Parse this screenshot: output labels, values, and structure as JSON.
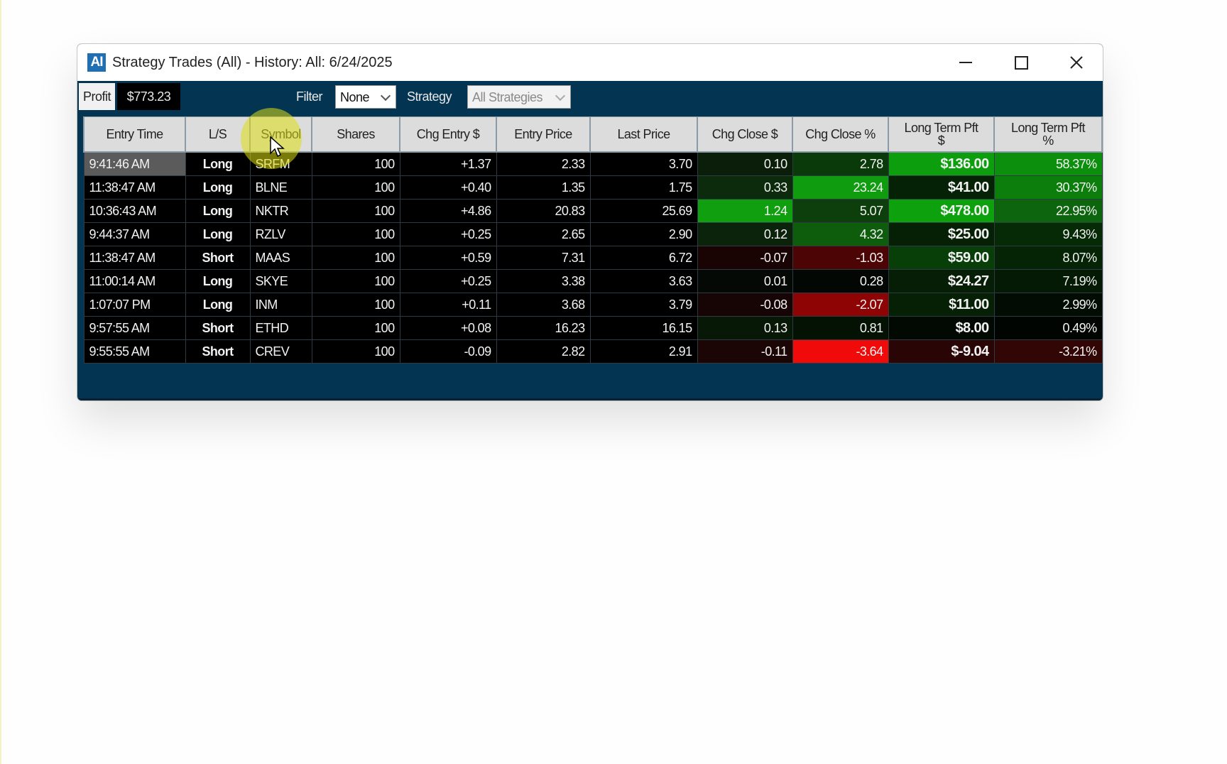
{
  "window": {
    "icon_text": "AI",
    "title": "Strategy Trades (All) - History: All: 6/24/2025"
  },
  "toolbar": {
    "profit_label": "Profit",
    "profit_value": "$773.23",
    "filter_label": "Filter",
    "filter_value": "None",
    "strategy_label": "Strategy",
    "strategy_value": "All Strategies"
  },
  "table": {
    "columns": [
      "Entry Time",
      "L/S",
      "Symbol",
      "Shares",
      "Chg Entry $",
      "Entry Price",
      "Last Price",
      "Chg Close $",
      "Chg Close %",
      "Long Term Pft $",
      "Long Term Pft %"
    ],
    "rows": [
      {
        "entry_time": "9:41:46 AM",
        "ls": "Long",
        "symbol": "SRFM",
        "shares": "100",
        "chg_entry": "+1.37",
        "entry_price": "2.33",
        "last_price": "3.70",
        "chg_close": "0.10",
        "chg_close_pct": "2.78",
        "lt_pft": "$136.00",
        "lt_pft_pct": "58.37%"
      },
      {
        "entry_time": "11:38:47 AM",
        "ls": "Long",
        "symbol": "BLNE",
        "shares": "100",
        "chg_entry": "+0.40",
        "entry_price": "1.35",
        "last_price": "1.75",
        "chg_close": "0.33",
        "chg_close_pct": "23.24",
        "lt_pft": "$41.00",
        "lt_pft_pct": "30.37%"
      },
      {
        "entry_time": "10:36:43 AM",
        "ls": "Long",
        "symbol": "NKTR",
        "shares": "100",
        "chg_entry": "+4.86",
        "entry_price": "20.83",
        "last_price": "25.69",
        "chg_close": "1.24",
        "chg_close_pct": "5.07",
        "lt_pft": "$478.00",
        "lt_pft_pct": "22.95%"
      },
      {
        "entry_time": "9:44:37 AM",
        "ls": "Long",
        "symbol": "RZLV",
        "shares": "100",
        "chg_entry": "+0.25",
        "entry_price": "2.65",
        "last_price": "2.90",
        "chg_close": "0.12",
        "chg_close_pct": "4.32",
        "lt_pft": "$25.00",
        "lt_pft_pct": "9.43%"
      },
      {
        "entry_time": "11:38:47 AM",
        "ls": "Short",
        "symbol": "MAAS",
        "shares": "100",
        "chg_entry": "+0.59",
        "entry_price": "7.31",
        "last_price": "6.72",
        "chg_close": "-0.07",
        "chg_close_pct": "-1.03",
        "lt_pft": "$59.00",
        "lt_pft_pct": "8.07%"
      },
      {
        "entry_time": "11:00:14 AM",
        "ls": "Long",
        "symbol": "SKYE",
        "shares": "100",
        "chg_entry": "+0.25",
        "entry_price": "3.38",
        "last_price": "3.63",
        "chg_close": "0.01",
        "chg_close_pct": "0.28",
        "lt_pft": "$24.27",
        "lt_pft_pct": "7.19%"
      },
      {
        "entry_time": "1:07:07 PM",
        "ls": "Long",
        "symbol": "INM",
        "shares": "100",
        "chg_entry": "+0.11",
        "entry_price": "3.68",
        "last_price": "3.79",
        "chg_close": "-0.08",
        "chg_close_pct": "-2.07",
        "lt_pft": "$11.00",
        "lt_pft_pct": "2.99%"
      },
      {
        "entry_time": "9:57:55 AM",
        "ls": "Short",
        "symbol": "ETHD",
        "shares": "100",
        "chg_entry": "+0.08",
        "entry_price": "16.23",
        "last_price": "16.15",
        "chg_close": "0.13",
        "chg_close_pct": "0.81",
        "lt_pft": "$8.00",
        "lt_pft_pct": "0.49%"
      },
      {
        "entry_time": "9:55:55 AM",
        "ls": "Short",
        "symbol": "CREV",
        "shares": "100",
        "chg_entry": "-0.09",
        "entry_price": "2.82",
        "last_price": "2.91",
        "chg_close": "-0.11",
        "chg_close_pct": "-3.64",
        "lt_pft": "$-9.04",
        "lt_pft_pct": "-3.21%"
      }
    ],
    "cell_colors": {
      "chg_close": [
        "#0a1e0a",
        "#0c2a0c",
        "#0f9f0f",
        "#0b220b",
        "#1a0303",
        "#050905",
        "#170404",
        "#071807",
        "#1c0505"
      ],
      "chg_close_pct": [
        "#0a3a0a",
        "#0f9c0f",
        "#0d3f0d",
        "#0d5d0d",
        "#4c0404",
        "#030703",
        "#8e0404",
        "#041204",
        "#f00a0a"
      ],
      "lt_pft": [
        "#0c9e0c",
        "#062206",
        "#0da10d",
        "#052005",
        "#083e08",
        "#051e05",
        "#052005",
        "#020802",
        "#2a0505"
      ],
      "lt_pft_pct": [
        "#0c8f0c",
        "#0c7e0c",
        "#0d650d",
        "#062a06",
        "#052305",
        "#041a04",
        "#020c02",
        "#010501",
        "#330606"
      ]
    },
    "selected_row": 0,
    "hover_column": "Symbol"
  },
  "icons": {
    "minimize": "minimize-icon",
    "maximize": "maximize-icon",
    "close": "close-icon",
    "dropdown": "chevron-down-icon",
    "pointer": "cursor-icon"
  }
}
